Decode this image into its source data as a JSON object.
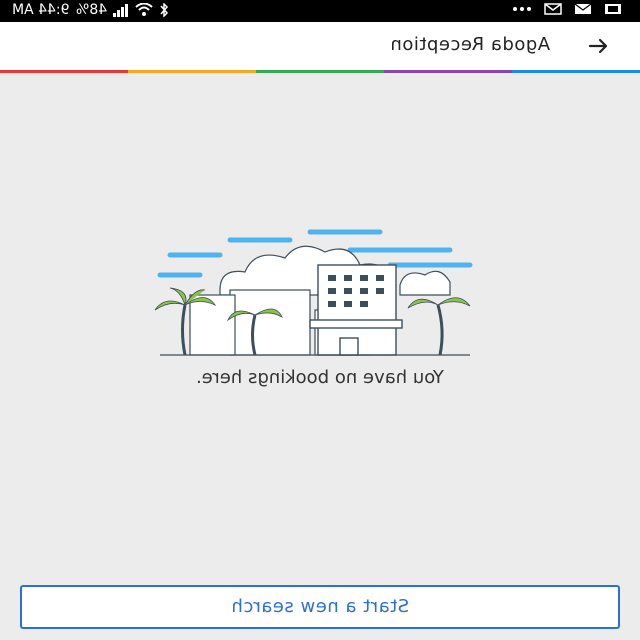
{
  "status_bar": {
    "time": "9:44 AM",
    "battery": "48%",
    "icons": [
      "wifi-icon",
      "signal-icon",
      "bluetooth-icon",
      "battery-icon",
      "mail-icon",
      "notification-icon",
      "more-icon"
    ]
  },
  "app_bar": {
    "title": "Agoda Reception",
    "back_icon": "arrow-left-icon"
  },
  "accent_stripe": [
    "#e53935",
    "#f5a623",
    "#34a853",
    "#8e44ad",
    "#1e88e5"
  ],
  "empty_state": {
    "message": "You have no bookings here."
  },
  "cta": {
    "label": "Start a new search"
  }
}
